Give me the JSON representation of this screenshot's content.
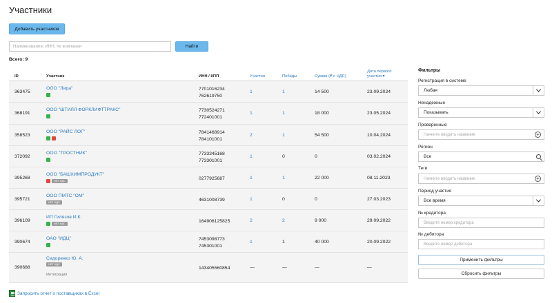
{
  "page": {
    "title": "Участники",
    "add_button": "Добавить участников",
    "search_placeholder": "Наименование, ИНН, № компании",
    "search_button": "Найти",
    "total": "Всего: 9",
    "excel_link": "Запросить отчет о поставщиках в Excel"
  },
  "table": {
    "headers": {
      "id": "ID",
      "participant": "Участник",
      "inn": "ИНН / КПП",
      "participations": "Участия",
      "wins": "Победы",
      "sum": "Сумма (₽ с НДС)",
      "date_line1": "Дата первого",
      "date_line2": "участия ▾"
    },
    "rows": [
      {
        "id": "363475",
        "name": "ООО \"Лира\"",
        "tags": [
          "green"
        ],
        "inn": "7701016234",
        "kpp": "762619750",
        "participations": "1",
        "participations_link": true,
        "wins": "1",
        "wins_link": true,
        "sum": "14 500",
        "date": "23.09.2024"
      },
      {
        "id": "368191",
        "name": "ООО \"ШТИЛЛ ФОРКЛИФТТРАКС\"",
        "tags": [
          "green"
        ],
        "inn": "7730524271",
        "kpp": "772401001",
        "participations": "1",
        "participations_link": true,
        "wins": "1",
        "wins_link": true,
        "sum": "18 000",
        "date": "23.05.2024"
      },
      {
        "id": "358523",
        "name": "ООО \"РАЙС ЛОГ\"",
        "tags": [
          "green",
          "red"
        ],
        "inn": "7841468914",
        "kpp": "784101001",
        "participations": "2",
        "participations_link": true,
        "wins": "1",
        "wins_link": true,
        "sum": "54 500",
        "date": "10.04.2024"
      },
      {
        "id": "372092",
        "name": "ООО \"ТРОСТНИК\"",
        "tags": [
          "green"
        ],
        "inn": "7733345168",
        "kpp": "773301001",
        "participations": "1",
        "participations_link": true,
        "wins": "0",
        "wins_link": false,
        "sum": "0",
        "date": "03.02.2024"
      },
      {
        "id": "395268",
        "name": "ООО \"БАШХИМПРОДУКТ\"",
        "tags": [
          "red",
          "nonds"
        ],
        "inn": "0277925687",
        "kpp": "",
        "participations": "1",
        "participations_link": true,
        "wins": "1",
        "wins_link": true,
        "sum": "22 000",
        "date": "08.11.2023"
      },
      {
        "id": "395721",
        "name": "ООО ПМТС \"ОМ\"",
        "tags": [
          "nonds"
        ],
        "inn": "4631008739",
        "kpp": "",
        "participations": "1",
        "participations_link": true,
        "wins": "0",
        "wins_link": false,
        "sum": "0",
        "date": "27.03.2023"
      },
      {
        "id": "396109",
        "name": "ИП Гилязов И.К.",
        "tags": [
          "green",
          "nonds"
        ],
        "inn": "164906125825",
        "kpp": "",
        "participations": "2",
        "participations_link": true,
        "wins": "2",
        "wins_link": true,
        "sum": "9 000",
        "date": "29.09.2022"
      },
      {
        "id": "390674",
        "name": "ОАО \"ИДЦ\"",
        "tags": [
          "green"
        ],
        "inn": "7453098773",
        "kpp": "745301001",
        "participations": "1",
        "participations_link": true,
        "wins": "1",
        "wins_link": false,
        "sum": "40 000",
        "date": "20.09.2022"
      },
      {
        "id": "390688",
        "name": "Сидоренко Ю. А.",
        "tags": [
          "nonds"
        ],
        "integration": "Интеграция",
        "inn": "143405560854",
        "kpp": "",
        "participations": "—",
        "participations_link": false,
        "wins": "—",
        "wins_link": false,
        "sum": "—",
        "date": "—"
      }
    ],
    "nonds_label": "НЕТ НДС"
  },
  "filters": {
    "title": "Фильтры",
    "registration_label": "Регистрация в системе",
    "registration_value": "Любая",
    "unreliable_label": "Ненадежные",
    "unreliable_value": "Показывать",
    "verified_label": "Проверенные",
    "verified_placeholder": "Начните вводить название",
    "region_label": "Регион",
    "region_value": "Все",
    "tags_label": "Теги",
    "tags_placeholder": "Начните вводить название",
    "period_label": "Период участия",
    "period_value": "Все время",
    "creditor_label": "№ кредитора",
    "creditor_placeholder": "Введите номер кредитора",
    "debtor_label": "№ дебитора",
    "debtor_placeholder": "Введите номер дебитора",
    "apply_button": "Применить фильтры",
    "reset_button": "Сбросить фильтры"
  },
  "colors": {
    "accent": "#6ab8ec",
    "link": "#2a7bc2",
    "ok": "#35b34a",
    "bad": "#e0483f"
  }
}
